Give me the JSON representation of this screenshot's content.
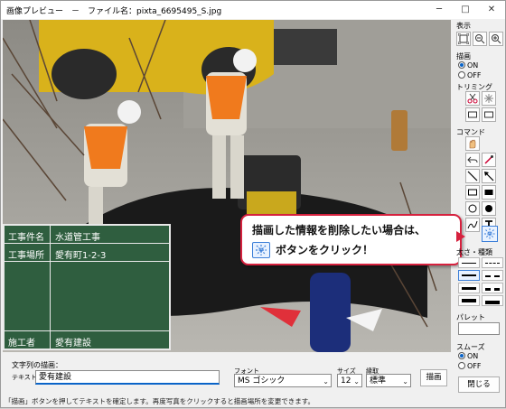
{
  "window": {
    "title": "画像プレビュー　－　ファイル名：pixta_6695495_S.jpg",
    "minimize": "─",
    "maximize": "□",
    "close": "✕"
  },
  "board": {
    "rows": [
      {
        "label": "工事件名",
        "value": "水道管工事"
      },
      {
        "label": "工事場所",
        "value": "愛有町1-2-3"
      },
      {
        "label": "施工者",
        "value": "愛有建設"
      }
    ]
  },
  "callout": {
    "line1": "描画した情報を削除したい場合は、",
    "line2": "ボタンをクリック！"
  },
  "sidebar": {
    "display_label": "表示",
    "draw_label": "描画",
    "draw_on": "ON",
    "draw_off": "OFF",
    "trim_label": "トリミング",
    "command_label": "コマンド",
    "thickness_label": "太さ・種類",
    "palette_label": "パレット",
    "smooth_label": "スムーズ",
    "smooth_on": "ON",
    "smooth_off": "OFF",
    "close_button": "閉じる"
  },
  "bottom": {
    "string_label": "文字列の描画：",
    "text_label": "テキスト",
    "text_value": "愛有建設",
    "font_label": "フォント",
    "font_value": "MS ゴシック",
    "size_label": "サイズ",
    "size_value": "12",
    "border_label": "縁取",
    "border_value": "標準",
    "draw_button": "描画"
  },
  "status": "「描画」ボタンを押してテキストを確定します。再度写真をクリックすると描画場所を変更できます。",
  "colors": {
    "board": "#2f5e3f",
    "callout_border": "#d6213e",
    "accent": "#0a64c8"
  }
}
